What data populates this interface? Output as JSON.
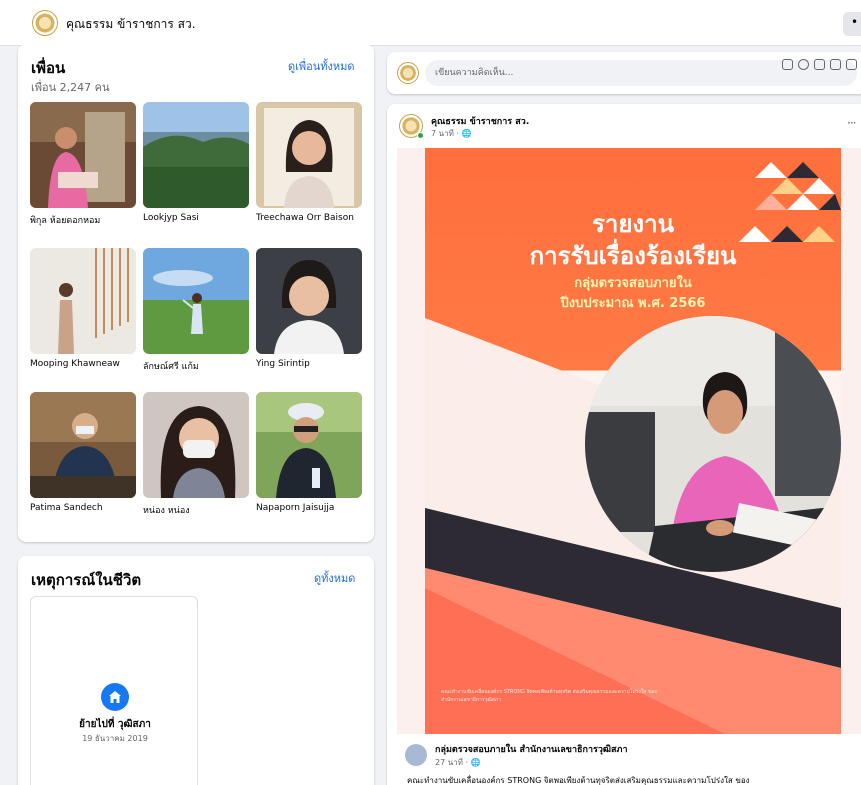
{
  "topbar": {
    "page_name": "คุณธรรม ข้าราชการ สว.",
    "more_label": "•"
  },
  "friends": {
    "heading": "เพื่อน",
    "count": "เพื่อน 2,247 คน",
    "see_all": "ดูเพื่อนทั้งหมด",
    "items": [
      {
        "name": "พิกุล ห้อยดอกหอม"
      },
      {
        "name": "Lookjyp Sasi"
      },
      {
        "name": "Treechawa Orr Baison"
      },
      {
        "name": "Mooping Khawneaw"
      },
      {
        "name": "ลักษณ์ศรี แก้ม"
      },
      {
        "name": "Ying Sirintip"
      },
      {
        "name": "Patima Sandech"
      },
      {
        "name": "หน่อง หน่อง"
      },
      {
        "name": "Napaporn Jaisujja"
      }
    ]
  },
  "life_events": {
    "heading": "เหตุการณ์ในชีวิต",
    "see_all": "ดูทั้งหมด",
    "event": {
      "title": "ย้ายไปที่ วุฒิสภา",
      "date": "19 ธันวาคม 2019",
      "icon": "home-icon"
    }
  },
  "composer": {
    "placeholder": "เขียนความคิดเห็น..."
  },
  "post": {
    "author": "คุณธรรม ข้าราชการ สว.",
    "time": "7 นาที · 🌐",
    "more_label": "···",
    "poster": {
      "line1": "รายงาน",
      "line2": "การรับเรื่องร้องเรียน",
      "line3": "กลุ่มตรวจสอบภายใน",
      "line4": "ปีงบประมาณ พ.ศ. 2566",
      "footer": "คณะทำงานขับเคลื่อนองค์กร STRONG จิตพอเพียงต้านทุจริต ส่งเสริมคุณธรรมและความโปร่งใส ของสำนักงานเลขาธิการวุฒิสภา"
    },
    "shared": {
      "group_name": "กลุ่มตรวจสอบภายใน สำนักงานเลขาธิการวุฒิสภา",
      "time": "27 นาที · 🌐",
      "text": "คณะทำงานขับเคลื่อนองค์กร STRONG จิตพอเพียงต้านทุจริตส่งเสริมคุณธรรมและความโปร่งใส ของ"
    }
  },
  "colors": {
    "link": "#216fdb",
    "poster_orange": "#ff6f3c",
    "accent_blue": "#1877f2"
  }
}
